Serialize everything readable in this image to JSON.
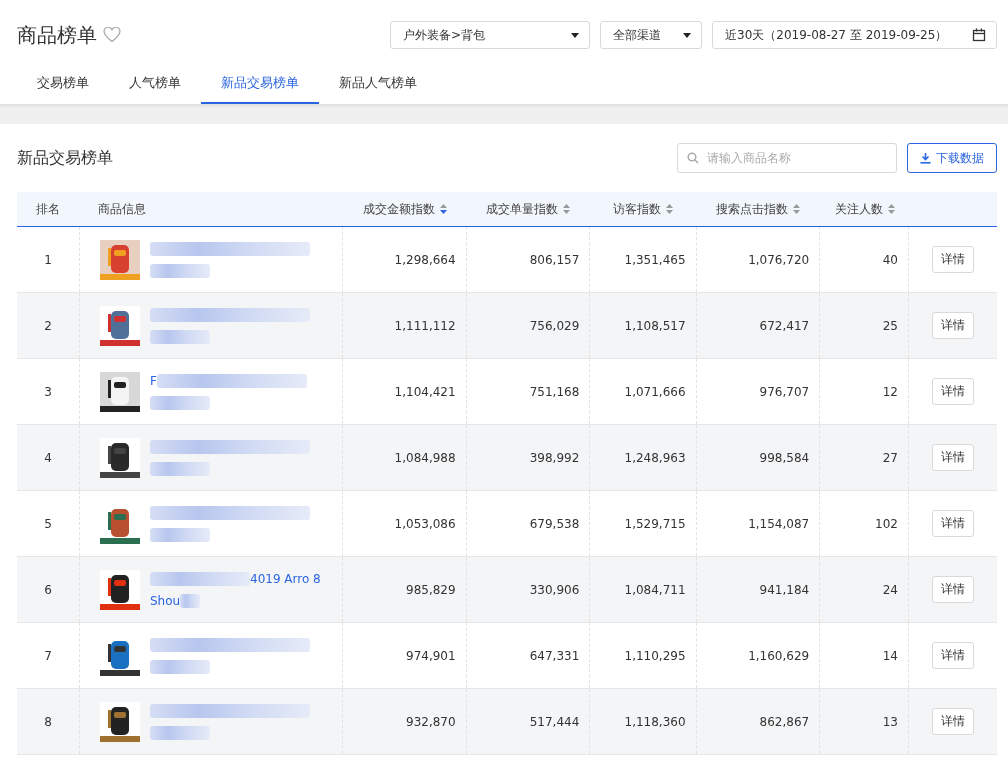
{
  "header": {
    "title": "商品榜单",
    "favorited": false,
    "category_select": "户外装备>背包",
    "channel_select": "全部渠道",
    "date_range": "近30天（2019-08-27 至 2019-09-25）"
  },
  "tabs": [
    {
      "label": "交易榜单",
      "selected": false
    },
    {
      "label": "人气榜单",
      "selected": false
    },
    {
      "label": "新品交易榜单",
      "selected": true
    },
    {
      "label": "新品人气榜单",
      "selected": false
    }
  ],
  "panel": {
    "title": "新品交易榜单",
    "search": {
      "placeholder": "请输入商品名称"
    },
    "download_button": "下载数据"
  },
  "table": {
    "columns": [
      {
        "label": "排名"
      },
      {
        "label": "商品信息"
      },
      {
        "label": "成交金额指数",
        "sorted": true
      },
      {
        "label": "成交单量指数",
        "sorted": false
      },
      {
        "label": "访客指数",
        "sorted": false
      },
      {
        "label": "搜索点击指数",
        "sorted": false
      },
      {
        "label": "关注人数",
        "sorted": false
      }
    ],
    "rows": [
      {
        "rank": "1",
        "product": {
          "image": {
            "kind": "picture"
          }
        },
        "amount": "1,298,664",
        "orders": "806,157",
        "visitors": "1,351,465",
        "search_clicks": "1,076,720",
        "follows": "40",
        "action": "详情"
      },
      {
        "rank": "2",
        "product": {
          "image": {
            "kind": "picture"
          }
        },
        "amount": "1,111,112",
        "orders": "756,029",
        "visitors": "1,108,517",
        "search_clicks": "672,417",
        "follows": "25",
        "action": "详情"
      },
      {
        "rank": "3",
        "product": {
          "image": {
            "kind": "picture"
          },
          "visible_text": [
            "F"
          ]
        },
        "amount": "1,104,421",
        "orders": "751,168",
        "visitors": "1,071,666",
        "search_clicks": "976,707",
        "follows": "12",
        "action": "详情"
      },
      {
        "rank": "4",
        "product": {
          "image": {
            "kind": "picture"
          }
        },
        "amount": "1,084,988",
        "orders": "398,992",
        "visitors": "1,248,963",
        "search_clicks": "998,584",
        "follows": "27",
        "action": "详情"
      },
      {
        "rank": "5",
        "product": {
          "image": {
            "kind": "picture"
          }
        },
        "amount": "1,053,086",
        "orders": "679,538",
        "visitors": "1,529,715",
        "search_clicks": "1,154,087",
        "follows": "102",
        "action": "详情"
      },
      {
        "rank": "6",
        "product": {
          "image": {
            "kind": "picture"
          },
          "visible_text": [
            "4019 Arro 8",
            "Shou"
          ]
        },
        "amount": "985,829",
        "orders": "330,906",
        "visitors": "1,084,711",
        "search_clicks": "941,184",
        "follows": "24",
        "action": "详情"
      },
      {
        "rank": "7",
        "product": {
          "image": {
            "kind": "picture"
          }
        },
        "amount": "974,901",
        "orders": "647,331",
        "visitors": "1,110,295",
        "search_clicks": "1,160,629",
        "follows": "14",
        "action": "详情"
      },
      {
        "rank": "8",
        "product": {
          "image": {
            "kind": "picture"
          }
        },
        "amount": "932,870",
        "orders": "517,444",
        "visitors": "1,118,360",
        "search_clicks": "862,867",
        "follows": "13",
        "action": "详情"
      }
    ]
  }
}
